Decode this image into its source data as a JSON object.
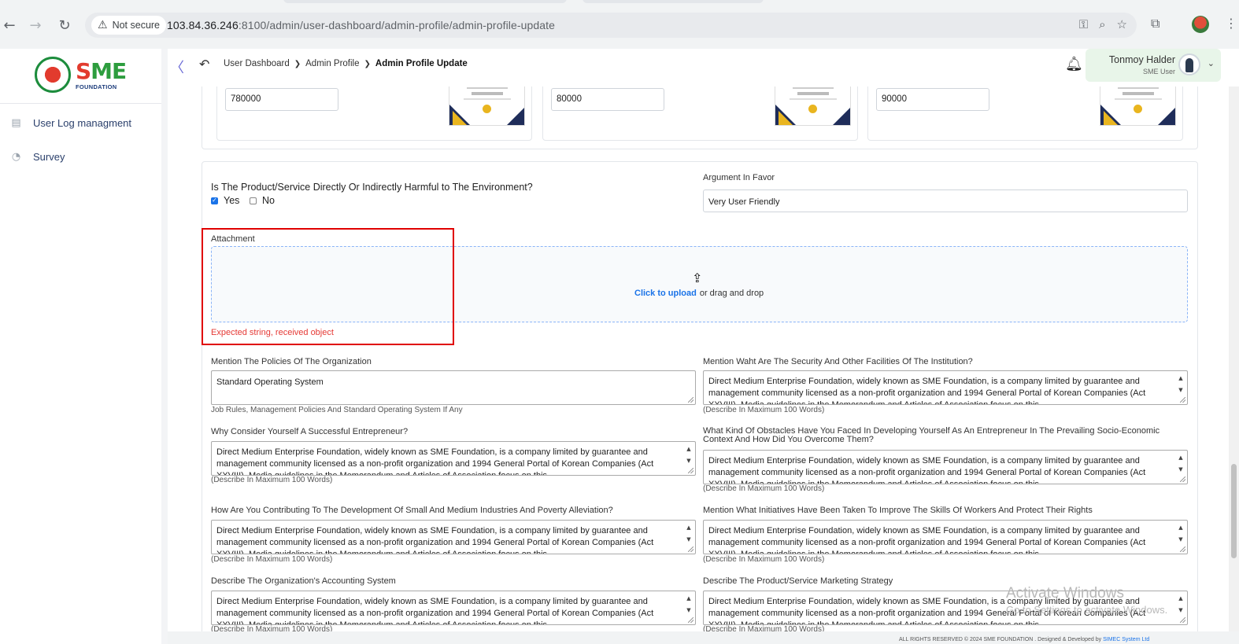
{
  "browser": {
    "not_secure": "Not secure",
    "url_host": "103.84.36.246",
    "url_path": ":8100/admin/user-dashboard/admin-profile/admin-profile-update"
  },
  "sidebar": {
    "logo_text": "SME",
    "logo_sub": "FOUNDATION",
    "items": [
      {
        "label": "User Log managment",
        "icon": "log-icon"
      },
      {
        "label": "Survey",
        "icon": "pie-chart-icon"
      }
    ]
  },
  "topbar": {
    "breadcrumb": [
      "User Dashboard",
      "Admin Profile",
      "Admin Profile Update"
    ],
    "user_name": "Tonmoy Halder",
    "user_role": "SME User"
  },
  "top_cards": [
    {
      "value": "780000"
    },
    {
      "value": "80000"
    },
    {
      "value": "90000"
    }
  ],
  "form": {
    "harmful_question": "Is The Product/Service Directly Or Indirectly Harmful to The Environment?",
    "yes_label": "Yes",
    "no_label": "No",
    "yes_checked": true,
    "argument_label": "Argument In Favor",
    "argument_value": "Very User Friendly",
    "attachment_label": "Attachment",
    "upload_link": "Click to upload",
    "upload_rest": "or drag and drop",
    "attachment_error": "Expected string, received object",
    "policies_label": "Mention The Policies Of The Organization",
    "policies_value": "Standard Operating System",
    "policies_hint": "Job Rules, Management Policies And Standard Operating System If Any",
    "security_label": "Mention Waht Are The Security And Other Facilities Of The Institution?",
    "entrepreneur_label": "Why Consider Yourself A Successful Entrepreneur?",
    "obstacles_label": "What Kind Of Obstacles Have You Faced In Developing Yourself As An Entrepreneur In The Prevailing Socio-Economic Context And How Did You Overcome Them?",
    "contributing_label": "How Are You Contributing To The Development Of Small And Medium Industries And Poverty Alleviation?",
    "initiatives_label": "Mention What Initiatives Have Been Taken To Improve The Skills Of Workers And Protect Their Rights",
    "accounting_label": "Describe The Organization's Accounting System",
    "marketing_label": "Describe The Product/Service Marketing Strategy",
    "describe_hint": "(Describe In Maximum 100 Words)",
    "long_text": "Direct Medium Enterprise Foundation, widely known as SME Foundation, is a company limited by guarantee and management community licensed as a non-profit organization and 1994 General Portal of Korean Companies (Act XXVIII). Media guidelines in the Memorandum and Articles of Association focus on this"
  },
  "watermark": {
    "title": "Activate Windows",
    "sub": "Go to Settings to activate Windows."
  },
  "footer": {
    "text": "ALL RIGHTS RESERVED © 2024 SME FOUNDATION . Designed & Developed by",
    "link": "SIMEC System Ltd"
  }
}
